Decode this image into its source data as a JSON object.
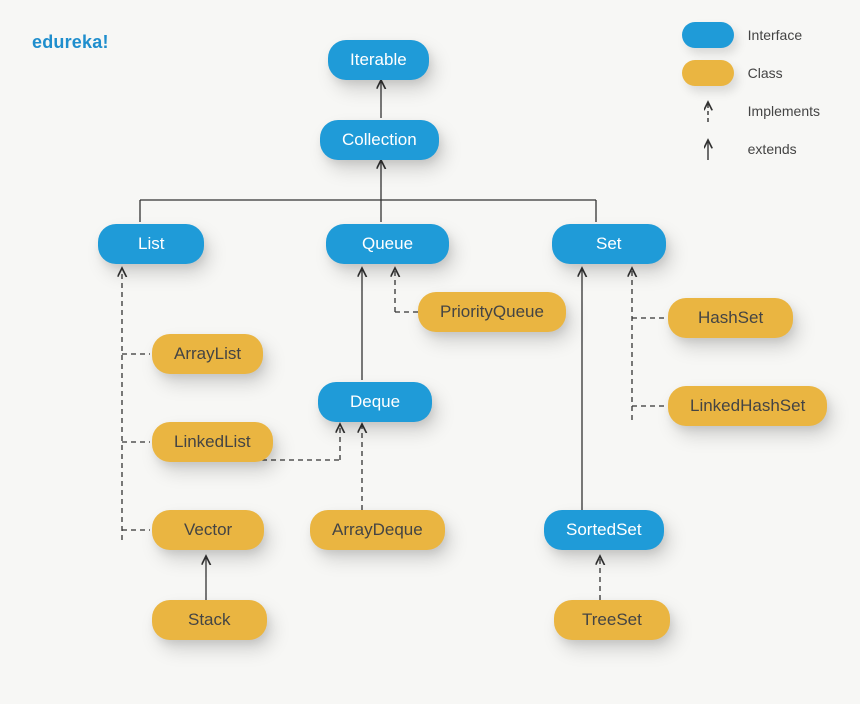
{
  "brand": "edureka!",
  "legend": {
    "interface_label": "Interface",
    "class_label": "Class",
    "implements_label": "Implements",
    "extends_label": "extends"
  },
  "nodes": {
    "iterable": {
      "label": "Iterable",
      "kind": "interface"
    },
    "collection": {
      "label": "Collection",
      "kind": "interface"
    },
    "list": {
      "label": "List",
      "kind": "interface"
    },
    "queue": {
      "label": "Queue",
      "kind": "interface"
    },
    "set": {
      "label": "Set",
      "kind": "interface"
    },
    "deque": {
      "label": "Deque",
      "kind": "interface"
    },
    "sortedset": {
      "label": "SortedSet",
      "kind": "interface"
    },
    "arraylist": {
      "label": "ArrayList",
      "kind": "class"
    },
    "linkedlist": {
      "label": "LinkedList",
      "kind": "class"
    },
    "vector": {
      "label": "Vector",
      "kind": "class"
    },
    "stack": {
      "label": "Stack",
      "kind": "class"
    },
    "priorityqueue": {
      "label": "PriorityQueue",
      "kind": "class"
    },
    "arraydeque": {
      "label": "ArrayDeque",
      "kind": "class"
    },
    "hashset": {
      "label": "HashSet",
      "kind": "class"
    },
    "linkedhashset": {
      "label": "LinkedHashSet",
      "kind": "class"
    },
    "treeset": {
      "label": "TreeSet",
      "kind": "class"
    }
  },
  "edges": [
    {
      "from": "collection",
      "to": "iterable",
      "rel": "extends"
    },
    {
      "from": "list",
      "to": "collection",
      "rel": "extends"
    },
    {
      "from": "queue",
      "to": "collection",
      "rel": "extends"
    },
    {
      "from": "set",
      "to": "collection",
      "rel": "extends"
    },
    {
      "from": "arraylist",
      "to": "list",
      "rel": "implements"
    },
    {
      "from": "linkedlist",
      "to": "list",
      "rel": "implements"
    },
    {
      "from": "vector",
      "to": "list",
      "rel": "implements"
    },
    {
      "from": "stack",
      "to": "vector",
      "rel": "extends"
    },
    {
      "from": "priorityqueue",
      "to": "queue",
      "rel": "implements"
    },
    {
      "from": "deque",
      "to": "queue",
      "rel": "extends"
    },
    {
      "from": "arraydeque",
      "to": "deque",
      "rel": "implements"
    },
    {
      "from": "linkedlist",
      "to": "deque",
      "rel": "implements"
    },
    {
      "from": "hashset",
      "to": "set",
      "rel": "implements"
    },
    {
      "from": "linkedhashset",
      "to": "set",
      "rel": "implements"
    },
    {
      "from": "sortedset",
      "to": "set",
      "rel": "extends"
    },
    {
      "from": "treeset",
      "to": "sortedset",
      "rel": "implements"
    }
  ]
}
